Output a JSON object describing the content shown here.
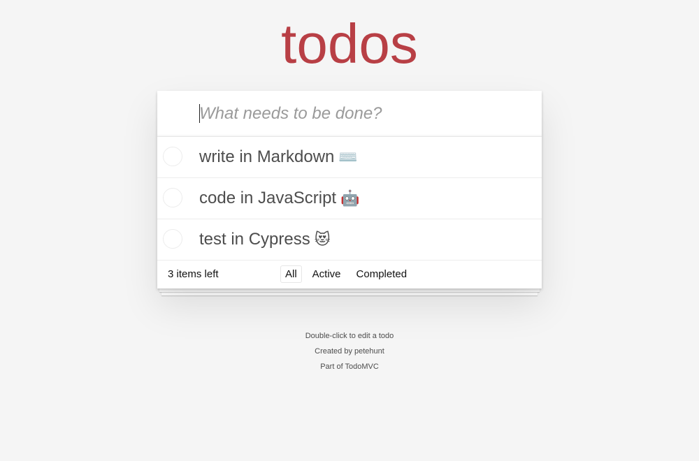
{
  "header": {
    "title": "todos"
  },
  "new_todo": {
    "value": "",
    "placeholder": "What needs to be done?"
  },
  "todos": [
    {
      "text": "write in Markdown",
      "emoji": "⌨️",
      "completed": false
    },
    {
      "text": "code in JavaScript",
      "emoji": "🤖",
      "completed": false
    },
    {
      "text": "test in Cypress",
      "emoji": "😻",
      "completed": false
    }
  ],
  "footer": {
    "items_left": "3 items left",
    "filters": [
      {
        "label": "All",
        "selected": true
      },
      {
        "label": "Active",
        "selected": false
      },
      {
        "label": "Completed",
        "selected": false
      }
    ]
  },
  "info": {
    "edit_hint": "Double-click to edit a todo",
    "created_by": "Created by petehunt",
    "part_of": "Part of TodoMVC"
  },
  "colors": {
    "title": "#b83f45",
    "background": "#f5f5f5",
    "text": "#4d4d4d"
  }
}
